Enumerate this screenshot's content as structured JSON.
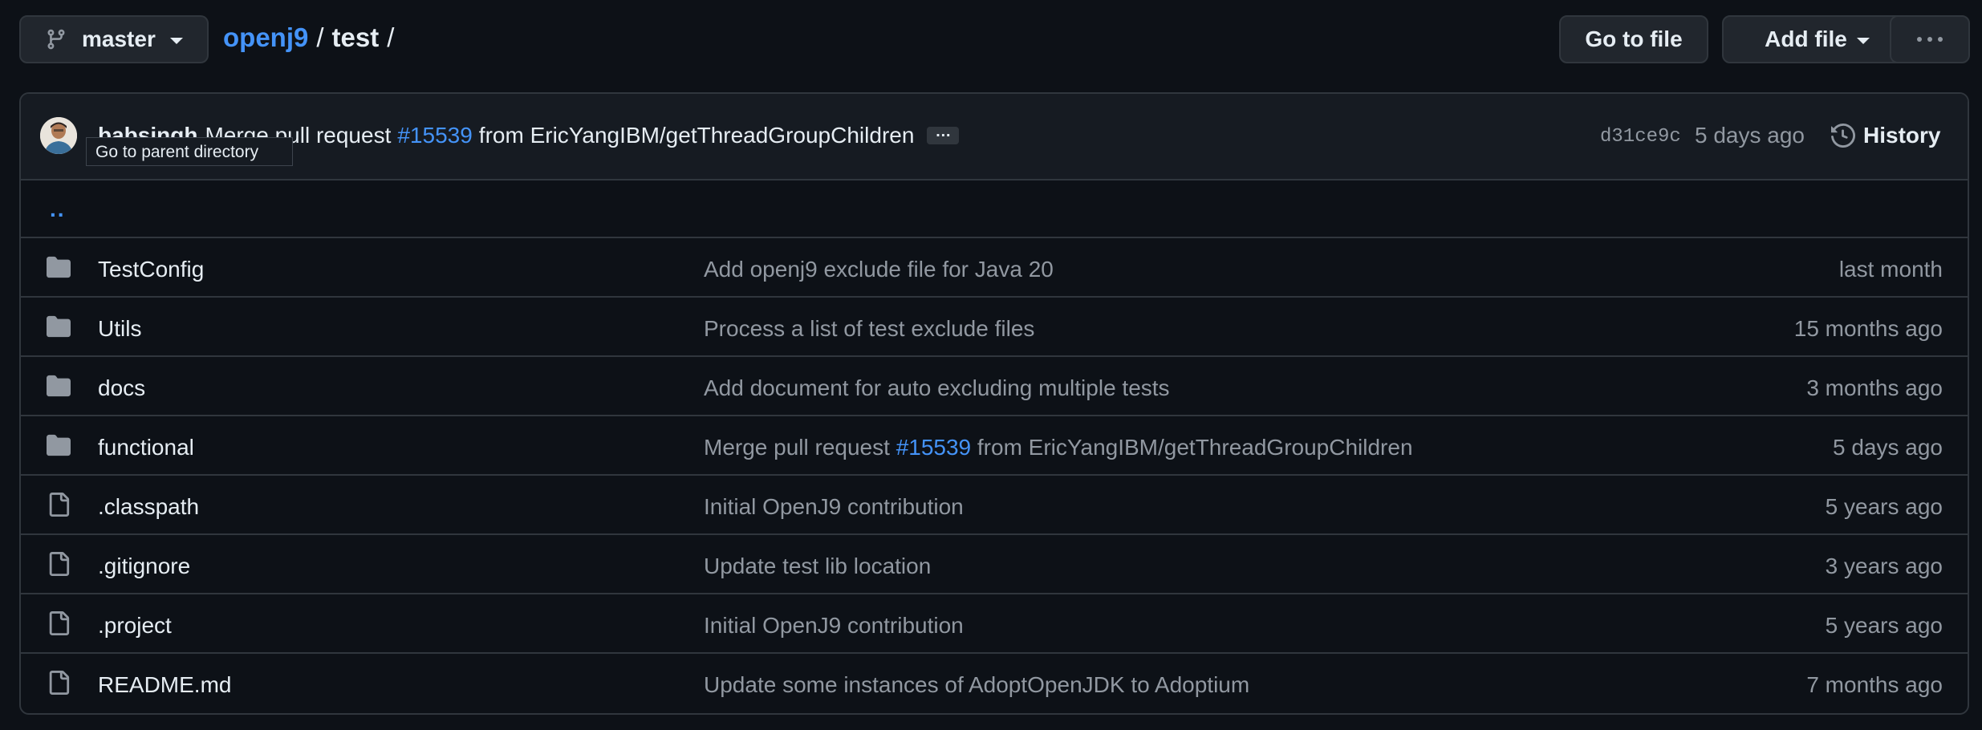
{
  "branch": {
    "name": "master"
  },
  "breadcrumb": {
    "repo": "openj9",
    "sep1": "/",
    "dir": "test",
    "sep2": "/"
  },
  "toolbar": {
    "go_to_file": "Go to file",
    "add_file": "Add file"
  },
  "commit": {
    "author": "babsingh",
    "msg_before": "Merge pull request",
    "pr": "#15539",
    "msg_after": "from EricYangIBM/getThreadGroupChildren",
    "ellipsis": "…",
    "sha": "d31ce9c",
    "age": "5 days ago",
    "history_label": "History"
  },
  "parent": {
    "label": "..",
    "tooltip": "Go to parent directory"
  },
  "files": [
    {
      "type": "dir",
      "icon": "folder-icon",
      "name": "TestConfig",
      "msg": "Add openj9 exclude file for Java 20",
      "age": "last month"
    },
    {
      "type": "dir",
      "icon": "folder-icon",
      "name": "Utils",
      "msg": "Process a list of test exclude files",
      "age": "15 months ago"
    },
    {
      "type": "dir",
      "icon": "folder-icon",
      "name": "docs",
      "msg": "Add document for auto excluding multiple tests",
      "age": "3 months ago"
    },
    {
      "type": "dir",
      "icon": "folder-icon",
      "name": "functional",
      "msg_before": "Merge pull request",
      "msg_pr": "#15539",
      "msg_after": "from EricYangIBM/getThreadGroupChildren",
      "age": "5 days ago"
    },
    {
      "type": "file",
      "icon": "file-icon",
      "name": ".classpath",
      "msg": "Initial OpenJ9 contribution",
      "age": "5 years ago"
    },
    {
      "type": "file",
      "icon": "file-icon",
      "name": ".gitignore",
      "msg": "Update test lib location",
      "age": "3 years ago"
    },
    {
      "type": "file",
      "icon": "file-icon",
      "name": ".project",
      "msg": "Initial OpenJ9 contribution",
      "age": "5 years ago"
    },
    {
      "type": "file",
      "icon": "file-icon",
      "name": "README.md",
      "msg": "Update some instances of AdoptOpenJDK to Adoptium",
      "age": "7 months ago"
    }
  ],
  "colors": {
    "bg": "#0d1117",
    "header_bg": "#161b22",
    "border": "#30363d",
    "link": "#4493f8",
    "muted": "#9198a1",
    "text": "#e6edf3"
  }
}
